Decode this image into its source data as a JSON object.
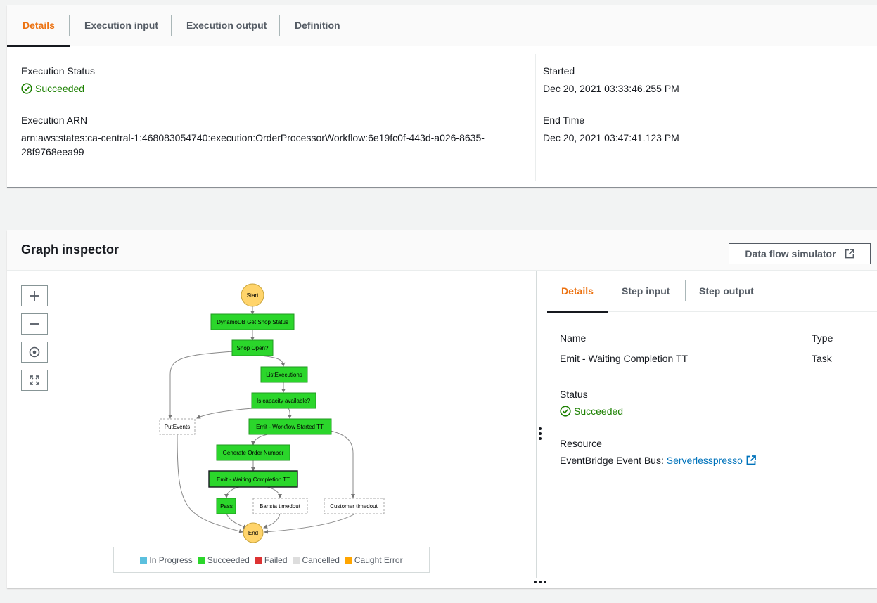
{
  "top_tabs": [
    {
      "label": "Details",
      "active": true
    },
    {
      "label": "Execution input",
      "active": false
    },
    {
      "label": "Execution output",
      "active": false
    },
    {
      "label": "Definition",
      "active": false
    }
  ],
  "details": {
    "status_label": "Execution Status",
    "status_value": "Succeeded",
    "arn_label": "Execution ARN",
    "arn_line1": "arn:aws:states:ca-central-1:468083054740:execution:OrderProcessorWorkflow:6e19fc0f-443d-a026-8635-",
    "arn_line2": "28f9768eea99",
    "started_label": "Started",
    "started_value": "Dec 20, 2021 03:33:46.255 PM",
    "end_label": "End Time",
    "end_value": "Dec 20, 2021 03:47:41.123 PM"
  },
  "graph_inspector": {
    "title": "Graph inspector",
    "data_flow_button": "Data flow simulator",
    "nodes": {
      "start": "Start",
      "dynamo": "DynamoDB Get Shop Status",
      "shop_open": "Shop Open?",
      "list_exec": "ListExecutions",
      "capacity": "Is capacity available?",
      "put_events": "PutEvents",
      "emit_started": "Emit - Workflow Started TT",
      "gen_order": "Generate Order Number",
      "emit_waiting": "Emit - Waiting Completion TT",
      "pass": "Pass",
      "barista": "Barista timedout",
      "customer": "Customer timedout",
      "end": "End"
    },
    "legend": [
      {
        "label": "In Progress",
        "color": "#5bc0de"
      },
      {
        "label": "Succeeded",
        "color": "#2bd62b"
      },
      {
        "label": "Failed",
        "color": "#dd3333"
      },
      {
        "label": "Cancelled",
        "color": "#dddddd"
      },
      {
        "label": "Caught Error",
        "color": "#ffa500"
      }
    ]
  },
  "step_panel": {
    "tabs": [
      {
        "label": "Details",
        "active": true
      },
      {
        "label": "Step input",
        "active": false
      },
      {
        "label": "Step output",
        "active": false
      }
    ],
    "name_label": "Name",
    "name_value": "Emit - Waiting Completion TT",
    "type_label": "Type",
    "type_value": "Task",
    "status_label": "Status",
    "status_value": "Succeeded",
    "resource_label": "Resource",
    "resource_prefix": "EventBridge Event Bus: ",
    "resource_link": "Serverlesspresso"
  },
  "colors": {
    "accent": "#ec7211",
    "success": "#1d8102",
    "link": "#0073bb",
    "node_green": "#2bd62b",
    "node_start": "#ffd46b"
  }
}
